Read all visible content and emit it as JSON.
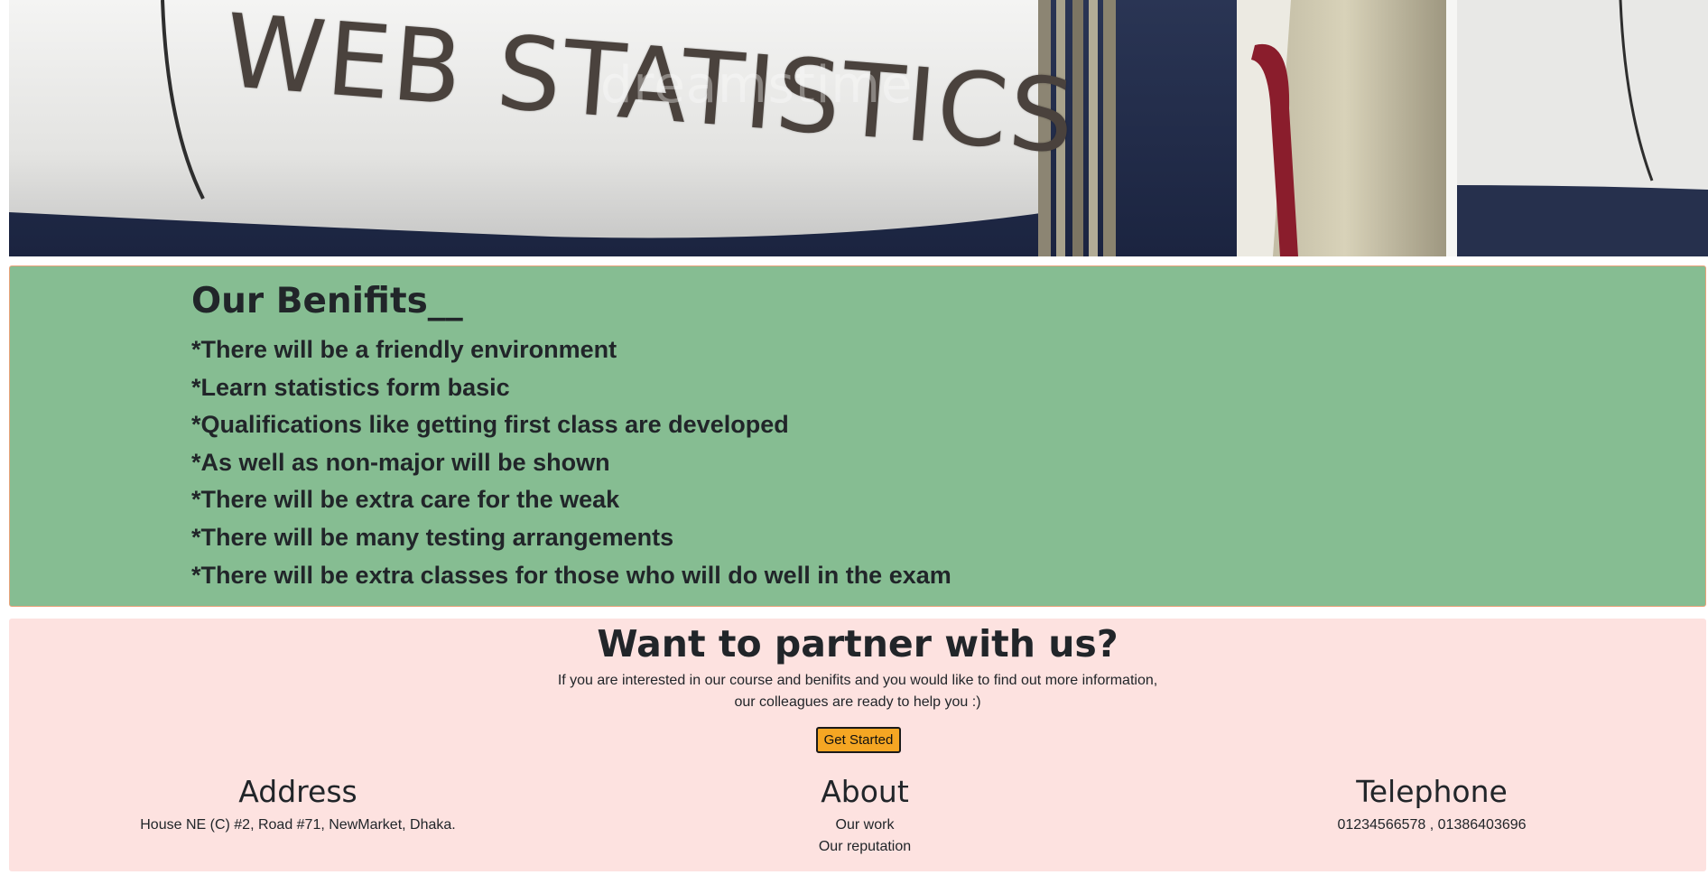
{
  "hero": {
    "image_text": "WEB STATISTICS",
    "watermark": "dreamstime"
  },
  "benefits": {
    "heading": "Our Benifits__",
    "items": [
      "*There will be a friendly environment",
      "*Learn statistics form basic",
      "*Qualifications like getting first class are developed",
      "*As well as non-major will be shown",
      "*There will be extra care for the weak",
      "*There will be many testing arrangements",
      "*There will be extra classes for those who will do well in the exam"
    ]
  },
  "partner": {
    "title": "Want to partner with us?",
    "text_line1": "If you are interested in our course and benifits and you would like to find out more information,",
    "text_line2": "our colleagues are ready to help you :)",
    "button_label": "Get Started"
  },
  "footer": {
    "address": {
      "heading": "Address",
      "text": "House NE (C) #2, Road #71, NewMarket, Dhaka."
    },
    "about": {
      "heading": "About",
      "links": [
        "Our work",
        "Our reputation"
      ]
    },
    "telephone": {
      "heading": "Telephone",
      "text": "01234566578 , 01386403696"
    }
  },
  "colors": {
    "benefits_bg": "#86bd92",
    "benefits_border": "#e9a27a",
    "partner_bg": "#fde2e0",
    "button_bg": "#f5a623"
  }
}
